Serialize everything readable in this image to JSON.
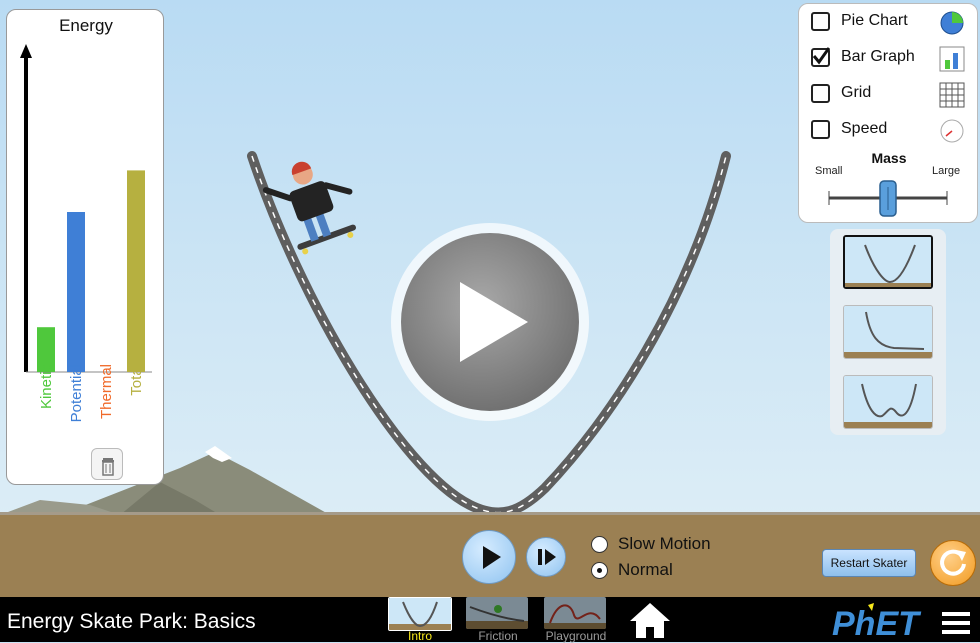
{
  "energy_panel": {
    "title": "Energy",
    "bars": [
      {
        "label": "Kinetic",
        "value": 0.14,
        "color": "#4fc83c"
      },
      {
        "label": "Potential",
        "value": 0.5,
        "color": "#3f7fd6"
      },
      {
        "label": "Thermal",
        "value": 0.0,
        "color": "#f06a2a"
      },
      {
        "label": "Total",
        "value": 0.63,
        "color": "#b6b040"
      }
    ]
  },
  "controls": {
    "checkboxes": [
      {
        "label": "Pie Chart",
        "checked": false,
        "icon": "pie-chart-icon"
      },
      {
        "label": "Bar Graph",
        "checked": true,
        "icon": "bar-graph-icon"
      },
      {
        "label": "Grid",
        "checked": false,
        "icon": "grid-icon"
      },
      {
        "label": "Speed",
        "checked": false,
        "icon": "speedometer-icon"
      }
    ],
    "mass": {
      "label": "Mass",
      "min_label": "Small",
      "max_label": "Large",
      "value": 0.5
    }
  },
  "playback": {
    "speed_options": [
      {
        "label": "Slow Motion",
        "selected": false
      },
      {
        "label": "Normal",
        "selected": true
      }
    ],
    "restart_label": "Restart Skater"
  },
  "navbar": {
    "title": "Energy Skate Park: Basics",
    "screens": [
      {
        "label": "Intro",
        "active": true
      },
      {
        "label": "Friction",
        "active": false
      },
      {
        "label": "Playground",
        "active": false
      }
    ],
    "brand": "PhET"
  },
  "colors": {
    "sky": "#c9e3f5",
    "ground": "#9b8053",
    "navbar": "#000000",
    "active_tab": "#f7e81c",
    "inactive_tab": "#9a9a9a"
  }
}
